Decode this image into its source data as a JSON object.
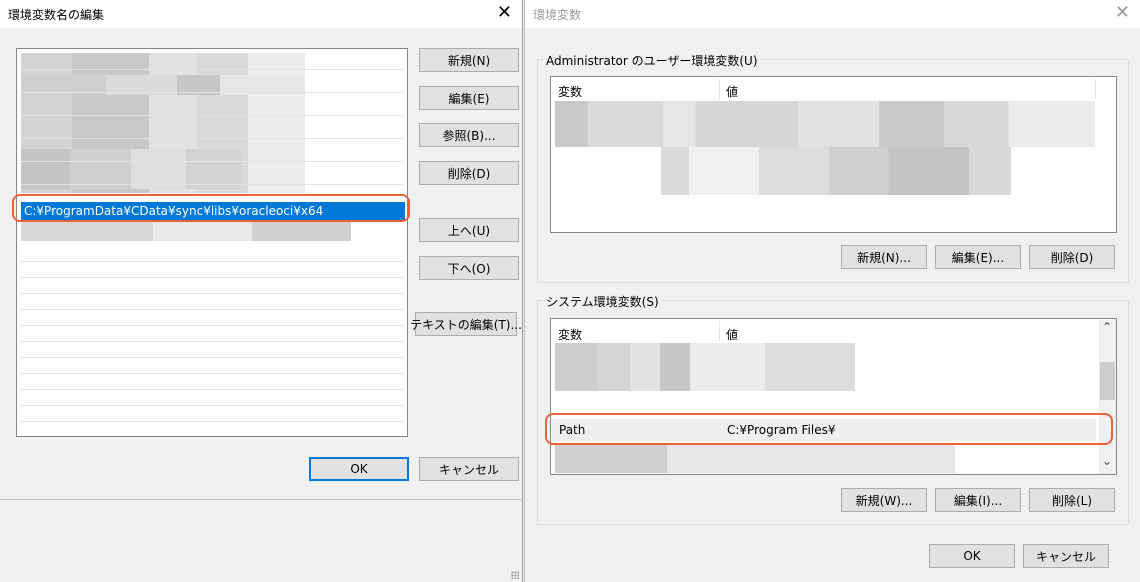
{
  "left_dialog": {
    "title": "環境変数名の編集",
    "close_glyph": "✕",
    "selected_path": "C:¥ProgramData¥CData¥sync¥libs¥oracleoci¥x64",
    "buttons": {
      "new": "新規(N)",
      "edit": "編集(E)",
      "browse": "参照(B)...",
      "delete": "削除(D)",
      "move_up": "上へ(U)",
      "move_down": "下へ(O)",
      "edit_text": "テキストの編集(T)...",
      "ok": "OK",
      "cancel": "キャンセル"
    }
  },
  "right_dialog": {
    "title": "環境変数",
    "close_glyph": "✕",
    "user_vars": {
      "group_label": "Administrator のユーザー環境変数(U)",
      "col_variable": "変数",
      "col_value": "値",
      "new": "新規(N)...",
      "edit": "編集(E)...",
      "delete": "削除(D)"
    },
    "system_vars": {
      "group_label": "システム環境変数(S)",
      "col_variable": "変数",
      "col_value": "値",
      "path_name": "Path",
      "path_value": "C:¥Program Files¥",
      "scroll_up_glyph": "⌃",
      "scroll_down_glyph": "⌄",
      "new": "新規(W)...",
      "edit": "編集(I)...",
      "delete": "削除(L)"
    },
    "ok": "OK",
    "cancel": "キャンセル"
  },
  "colors": {
    "selection": "#0078d7",
    "highlight_box": "#e8643c",
    "default_button_border": "#0078d7"
  }
}
